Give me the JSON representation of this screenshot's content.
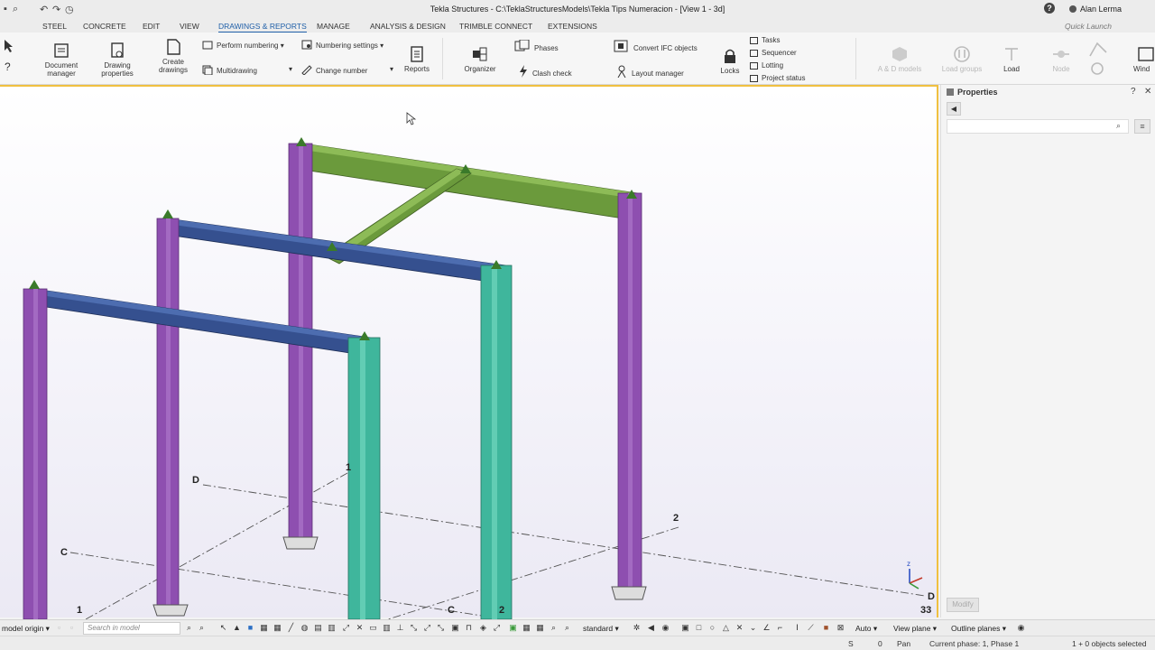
{
  "window": {
    "title": "Tekla Structures - C:\\TeklaStructuresModels\\Tekla Tips Numeracion - [View 1 - 3d]",
    "user": "Alan Lerma",
    "help_icon": "?"
  },
  "menu": {
    "tabs": [
      "STEEL",
      "CONCRETE",
      "EDIT",
      "VIEW",
      "DRAWINGS & REPORTS",
      "MANAGE",
      "ANALYSIS & DESIGN",
      "TRIMBLE CONNECT",
      "EXTENSIONS"
    ],
    "active_tab": "DRAWINGS & REPORTS",
    "quick_launch_placeholder": "Quick Launch"
  },
  "ribbon": {
    "document_manager": "Document manager",
    "drawing_properties": "Drawing properties",
    "create_drawings": "Create drawings",
    "perform_numbering": "Perform numbering",
    "multidrawing": "Multidrawing",
    "numbering_settings": "Numbering settings",
    "change_number": "Change number",
    "reports": "Reports",
    "organizer": "Organizer",
    "phases": "Phases",
    "clash_check": "Clash check",
    "convert_ifc": "Convert IFC objects",
    "layout_manager": "Layout manager",
    "locks": "Locks",
    "tasks": "Tasks",
    "sequencer": "Sequencer",
    "lotting": "Lotting",
    "project_status": "Project status",
    "ad_models": "A & D models",
    "load_groups": "Load groups",
    "load": "Load",
    "node": "Node",
    "window": "Wind"
  },
  "viewport": {
    "grid_labels": [
      "D",
      "1",
      "2",
      "C",
      "1",
      "C",
      "2",
      "D",
      "33"
    ],
    "axis_label": "z",
    "colors": {
      "column_purple": "#8e4fb0",
      "column_teal": "#3fb69c",
      "beam_blue": "#35508f",
      "beam_green": "#6b9a3c"
    }
  },
  "properties": {
    "title": "Properties",
    "help": "?",
    "close": "✕",
    "back": "◀",
    "menu": "≡",
    "modify": "Modify"
  },
  "bottombar": {
    "origin": "model origin",
    "search_placeholder": "Search in model",
    "standard": "standard",
    "auto": "Auto",
    "view_plane": "View plane",
    "outline_planes": "Outline planes"
  },
  "status": {
    "s": "S",
    "zero": "0",
    "pan": "Pan",
    "phase": "Current phase: 1, Phase 1",
    "selected": "1 + 0 objects selected"
  }
}
